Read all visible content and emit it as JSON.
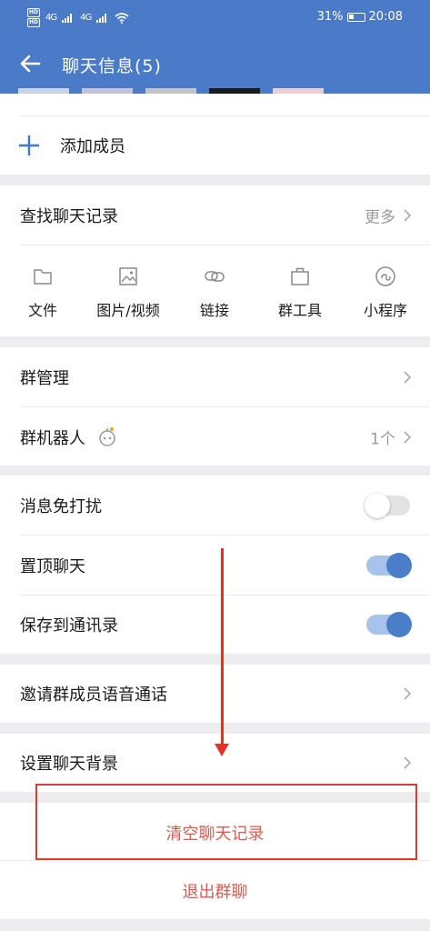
{
  "status_bar": {
    "hd_top": "HD",
    "hd_bottom": "HD",
    "net1": "4G",
    "net2": "4G",
    "battery": "31%",
    "time": "20:08"
  },
  "header": {
    "title": "聊天信息(5)"
  },
  "add_member": {
    "label": "添加成员"
  },
  "chat_history": {
    "label": "查找聊天记录",
    "more": "更多",
    "tools": [
      {
        "label": "文件",
        "icon": "folder-icon"
      },
      {
        "label": "图片/视频",
        "icon": "image-icon"
      },
      {
        "label": "链接",
        "icon": "link-icon"
      },
      {
        "label": "群工具",
        "icon": "briefcase-icon"
      },
      {
        "label": "小程序",
        "icon": "mini-program-icon"
      }
    ]
  },
  "group_manage": {
    "label": "群管理"
  },
  "group_robot": {
    "label": "群机器人",
    "count": "1个"
  },
  "settings": {
    "mute": {
      "label": "消息免打扰",
      "on": false
    },
    "pin": {
      "label": "置顶聊天",
      "on": true
    },
    "save_contacts": {
      "label": "保存到通讯录",
      "on": true
    }
  },
  "invite_voice": {
    "label": "邀请群成员语音通话"
  },
  "background": {
    "label": "设置聊天背景"
  },
  "clear_history": {
    "label": "清空聊天记录"
  },
  "exit_group": {
    "label": "退出群聊"
  },
  "colors": {
    "header_bg": "#4a7ac8",
    "accent_blue": "#3a78d6",
    "danger_red": "#e05a4e",
    "annotation_red": "#e0322b"
  }
}
